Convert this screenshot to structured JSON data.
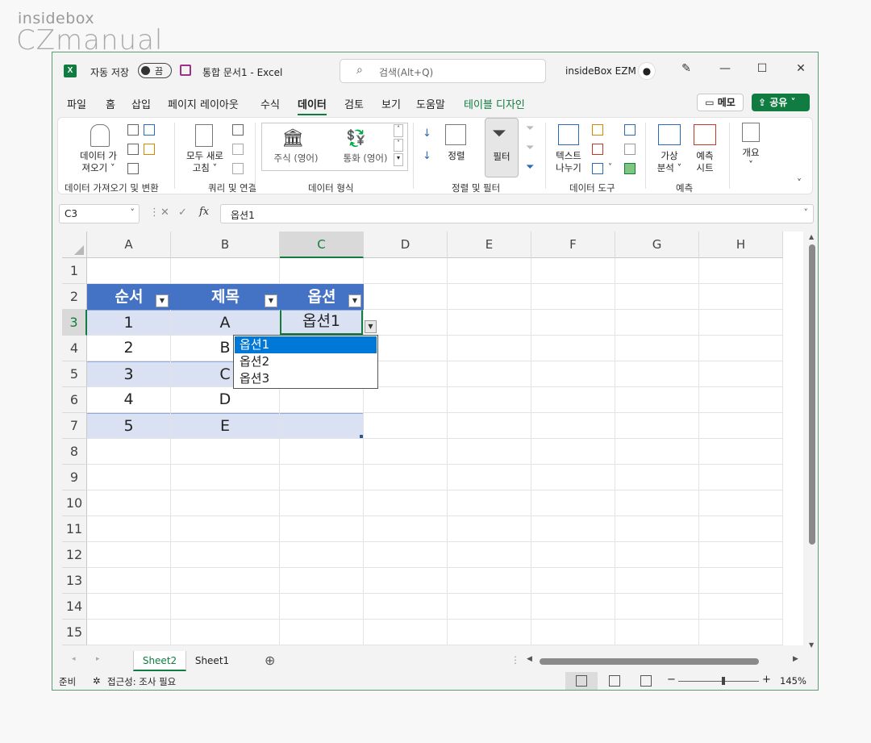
{
  "watermark": {
    "top": "insidebox",
    "bottom": "CZmanual"
  },
  "titlebar": {
    "logo": "X",
    "autosave_label": "자동 저장",
    "autosave_state": "끔",
    "doc_title": "통합 문서1  -  Excel",
    "search_placeholder": "검색(Alt+Q)",
    "user_name": "insideBox EZM",
    "minimize": "—",
    "maximize": "☐",
    "close": "✕"
  },
  "tabs": [
    "파일",
    "홈",
    "삽입",
    "페이지 레이아웃",
    "수식",
    "데이터",
    "검토",
    "보기",
    "도움말",
    "테이블 디자인"
  ],
  "tab_active": "데이터",
  "tab_buttons": {
    "memo": "메모",
    "share": "공유"
  },
  "ribbon": {
    "get_data_l1": "데이터 가",
    "get_data_l2": "져오기 ˅",
    "refresh_l1": "모두 새로",
    "refresh_l2": "고침 ˅",
    "stock": "주식 (영어)",
    "currency": "통화 (영어)",
    "sort": "정렬",
    "filter": "필터",
    "text_to_col_l1": "텍스트",
    "text_to_col_l2": "나누기",
    "whatif_l1": "가상",
    "whatif_l2": "분석 ˅",
    "forecast_l1": "예측",
    "forecast_l2": "시트",
    "outline": "개요",
    "outline_arrow": "˅",
    "groups": [
      "데이터 가져오기 및 변환",
      "쿼리 및 연결",
      "데이터 형식",
      "정렬 및 필터",
      "데이터 도구",
      "예측"
    ],
    "collapse": "˅"
  },
  "formula_bar": {
    "name_box": "C3",
    "fx": "fx",
    "value": "옵션1"
  },
  "columns": [
    "A",
    "B",
    "C",
    "D",
    "E",
    "F",
    "G",
    "H"
  ],
  "rows": [
    "1",
    "2",
    "3",
    "4",
    "5",
    "6",
    "7",
    "8",
    "9",
    "10",
    "11",
    "12",
    "13",
    "14",
    "15"
  ],
  "table": {
    "headers": [
      "순서",
      "제목",
      "옵션"
    ],
    "rows": [
      [
        "1",
        "A",
        "옵션1"
      ],
      [
        "2",
        "B",
        ""
      ],
      [
        "3",
        "C",
        ""
      ],
      [
        "4",
        "D",
        ""
      ],
      [
        "5",
        "E",
        ""
      ]
    ]
  },
  "dropdown": {
    "options": [
      "옵션1",
      "옵션2",
      "옵션3"
    ],
    "selected": "옵션1"
  },
  "sheets": [
    "Sheet2",
    "Sheet1"
  ],
  "sheet_active": "Sheet2",
  "add_sheet": "⊕",
  "status": {
    "ready": "준비",
    "accessibility": "접근성: 조사 필요",
    "zoom": "145%",
    "zoom_minus": "−",
    "zoom_plus": "+"
  },
  "colors": {
    "accent": "#107c41",
    "table_header": "#4472c4",
    "band": "#d9e1f2",
    "dropdown_sel": "#0078d7"
  }
}
